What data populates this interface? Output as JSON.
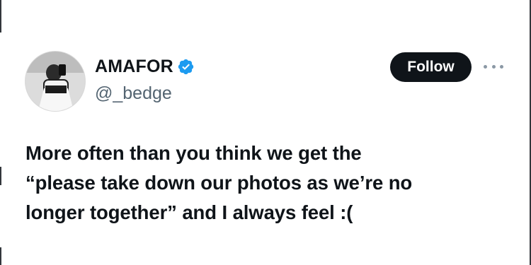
{
  "user": {
    "display_name": "AMAFOR",
    "handle": "@_bedge",
    "verified": true,
    "verified_icon": "verified-badge-icon",
    "verified_color": "#1d9bf0"
  },
  "actions": {
    "follow_label": "Follow",
    "more_icon": "more-horizontal-icon"
  },
  "tweet": {
    "lines": [
      "More often than you think we get the",
      "“please take down our photos as we’re no",
      "longer together” and I always feel :("
    ]
  }
}
